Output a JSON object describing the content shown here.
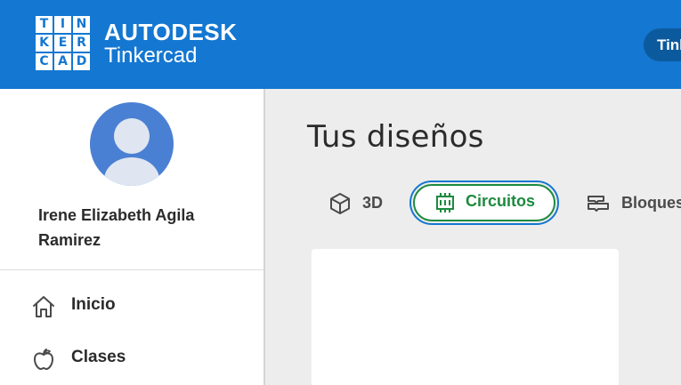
{
  "header": {
    "logo_letters": [
      "T",
      "I",
      "N",
      "K",
      "E",
      "R",
      "C",
      "A",
      "D"
    ],
    "brand_company": "AUTODESK",
    "brand_product": "Tinkercad",
    "pill_text": "Tinkercad"
  },
  "sidebar": {
    "user_name": "Irene Elizabeth Agila Ramirez",
    "nav": [
      {
        "label": "Inicio",
        "icon": "home-icon"
      },
      {
        "label": "Clases",
        "icon": "apple-icon"
      }
    ]
  },
  "main": {
    "title": "Tus diseños",
    "tabs": [
      {
        "label": "3D",
        "icon": "cube-icon",
        "selected": false
      },
      {
        "label": "Circuitos",
        "icon": "chip-icon",
        "selected": true
      },
      {
        "label": "Bloques",
        "icon": "blocks-icon",
        "selected": false
      }
    ]
  },
  "colors": {
    "header_blue": "#1477d1",
    "selected_green": "#1d8a3e",
    "avatar_blue": "#4a80d3",
    "background": "#ededed"
  }
}
